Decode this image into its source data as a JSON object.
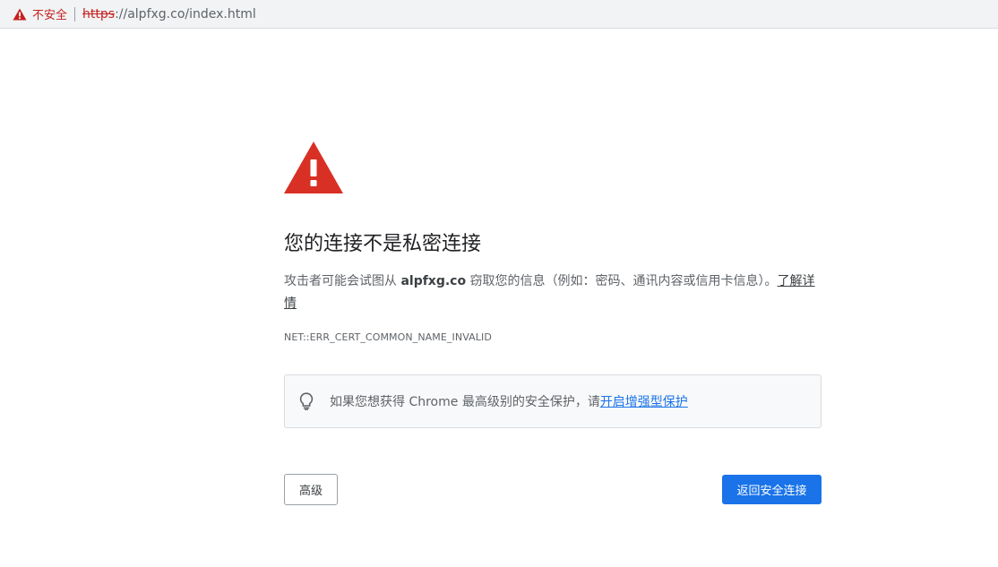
{
  "omnibox": {
    "security_label": "不安全",
    "url_scheme": "https",
    "url_rest": "://alpfxg.co/index.html"
  },
  "interstitial": {
    "heading": "您的连接不是私密连接",
    "explanation_before": "攻击者可能会试图从 ",
    "domain": "alpfxg.co",
    "explanation_after": " 窃取您的信息（例如：密码、通讯内容或信用卡信息）。",
    "learn_more": "了解详情",
    "error_code": "NET::ERR_CERT_COMMON_NAME_INVALID",
    "enhanced_text": "如果您想获得 Chrome 最高级别的安全保护，请",
    "enhanced_link": "开启增强型保护",
    "advanced_button": "高级",
    "back_button": "返回安全连接"
  },
  "colors": {
    "danger": "#d93025",
    "not_secure": "#c5221f",
    "primary_button": "#1a73e8",
    "link": "#1a73e8"
  },
  "icons": {
    "omnibox_warning": "warning-triangle-icon",
    "danger": "danger-triangle-icon",
    "bulb": "lightbulb-icon"
  }
}
